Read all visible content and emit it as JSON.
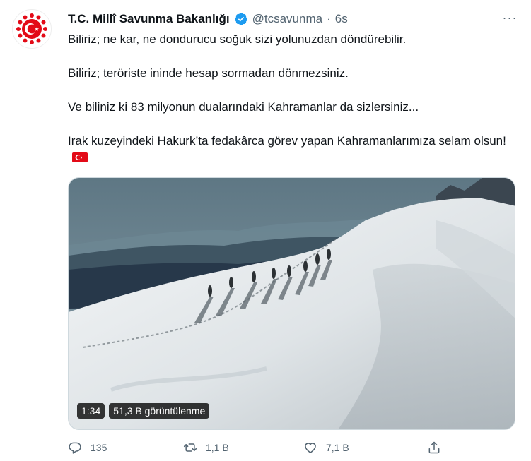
{
  "tweet": {
    "author_name": "T.C. Millî Savunma Bakanlığı",
    "handle": "@tcsavunma",
    "separator": "·",
    "time": "6s",
    "more_label": "···",
    "paragraphs": [
      "Biliriz; ne kar, ne dondurucu soğuk sizi yolunuzdan döndürebilir.",
      "Biliriz; teröriste ininde hesap sormadan dönmezsiniz.",
      "Ve biliniz ki 83 milyonun dualarındaki Kahramanlar da sizlersiniz...",
      "Irak kuzeyindeki Hakurk’ta fedakârca görev yapan Kahramanlarımıza selam olsun!"
    ],
    "flag_icon": "turkey-flag-emoji"
  },
  "video": {
    "duration": "1:34",
    "views": "51,3 B görüntülenme"
  },
  "actions": {
    "reply_count": "135",
    "retweet_count": "1,1 B",
    "like_count": "7,1 B"
  },
  "colors": {
    "text_primary": "#0f1419",
    "text_secondary": "#536471",
    "verified_blue": "#1d9bf0",
    "flag_red": "#e30a17"
  }
}
